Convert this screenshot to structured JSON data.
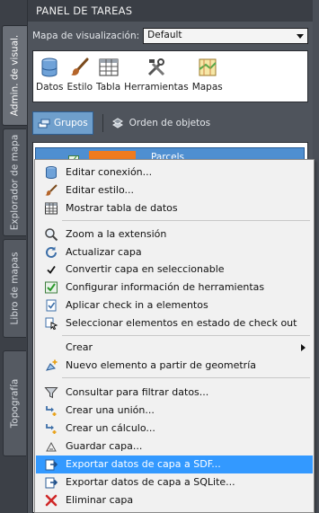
{
  "side_tabs": [
    {
      "label": "Admin. de visual."
    },
    {
      "label": "Explorador de mapa"
    },
    {
      "label": "Libro de mapas"
    },
    {
      "label": "Topografía"
    }
  ],
  "panel": {
    "title": "PANEL DE TAREAS",
    "map_display": {
      "label": "Mapa de visualización:",
      "value": "Default"
    },
    "toolbar": {
      "data": "Datos",
      "style": "Estilo",
      "table": "Tabla",
      "tools": "Herramientas",
      "maps": "Mapas"
    },
    "groups_button": "Grupos",
    "object_order_button": "Orden de objetos",
    "layer_name": "Parcels"
  },
  "context_menu": {
    "items": [
      {
        "label": "Editar conexión...",
        "icon": "database-icon"
      },
      {
        "label": "Editar estilo...",
        "icon": "brush-icon"
      },
      {
        "label": "Mostrar tabla de datos",
        "icon": "table-icon"
      },
      {
        "label": "Zoom a la extensión",
        "icon": "zoom-icon"
      },
      {
        "label": "Actualizar capa",
        "icon": "refresh-icon"
      },
      {
        "label": "Convertir capa en seleccionable",
        "icon": "checkmark-icon"
      },
      {
        "label": "Configurar información de herramientas",
        "icon": "configure-icon"
      },
      {
        "label": "Aplicar check in a elementos",
        "icon": "check-in-icon"
      },
      {
        "label": "Seleccionar elementos en estado de check out",
        "icon": "select-checkout-icon"
      },
      {
        "label": "Crear",
        "icon": ""
      },
      {
        "label": "Nuevo elemento a partir de geometría",
        "icon": "new-feature-icon"
      },
      {
        "label": "Consultar para filtrar datos...",
        "icon": "filter-icon"
      },
      {
        "label": "Crear una unión...",
        "icon": "join-icon"
      },
      {
        "label": "Crear un cálculo...",
        "icon": "calculation-icon"
      },
      {
        "label": "Guardar capa...",
        "icon": "save-layer-icon"
      },
      {
        "label": "Exportar datos de capa a SDF...",
        "icon": "export-sdf-icon"
      },
      {
        "label": "Exportar datos de capa a SQLite...",
        "icon": "export-sqlite-icon"
      },
      {
        "label": "Eliminar capa",
        "icon": "delete-icon"
      }
    ]
  },
  "colors": {
    "highlight": "#3399ff",
    "layer_swatch": "#ef7b1f",
    "groups_button": "#6f9fcc"
  }
}
